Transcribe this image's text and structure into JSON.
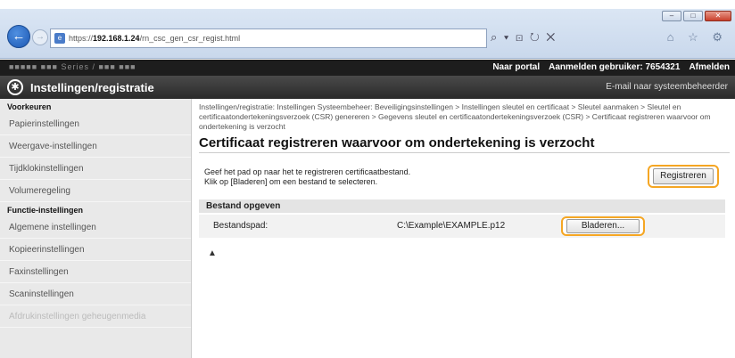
{
  "browser": {
    "url_prefix": "https://",
    "url_host": "192.168.1.24",
    "url_path": "/rn_csc_gen_csr_regist.html",
    "search_placeholder": "",
    "tool_glyphs": "⌕ ▾ ⊡ ↻ ✕",
    "right_glyphs": "⌂ ☆ ⚙"
  },
  "menubar": {
    "device_name": "■■■■■  ■■■ Series / ■■■ ■■■",
    "portal_link": "Naar portal",
    "login_label": "Aanmelden gebruiker:",
    "login_user": "7654321",
    "logout_link": "Afmelden"
  },
  "titlebar": {
    "title": "Instellingen/registratie",
    "mail_link": "E-mail naar systeembeheerder"
  },
  "sidebar": {
    "section1": "Voorkeuren",
    "items1": [
      "Papierinstellingen",
      "Weergave-instellingen",
      "Tijdklokinstellingen",
      "Volumeregeling"
    ],
    "section2": "Functie-instellingen",
    "items2": [
      "Algemene instellingen",
      "Kopieerinstellingen",
      "Faxinstellingen",
      "Scaninstellingen"
    ],
    "faded_item": "Afdrukinstellingen geheugenmedia"
  },
  "content": {
    "breadcrumb": "Instellingen/registratie: Instellingen Systeembeheer: Beveiligingsinstellingen > Instellingen sleutel en certificaat > Sleutel aanmaken > Sleutel en certificaatondertekeningsverzoek (CSR) genereren > Gegevens sleutel en certificaatondertekeningsverzoek (CSR) > Certificaat registreren waarvoor om ondertekening is verzocht",
    "page_title": "Certificaat registreren waarvoor om ondertekening is verzocht",
    "intro_line1": "Geef het pad op naar het te registreren certificaatbestand.",
    "intro_line2": "Klik op [Bladeren] om een bestand te selecteren.",
    "register_button": "Registreren",
    "section_title": "Bestand opgeven",
    "file_path_label": "Bestandspad:",
    "file_path_value": "C:\\Example\\EXAMPLE.p12",
    "browse_button": "Bladeren...",
    "top_anchor": "▲"
  },
  "colors": {
    "highlight": "#f5a623",
    "titlebar": "#2a2a2a",
    "sidebar": "#e9e9e9"
  }
}
